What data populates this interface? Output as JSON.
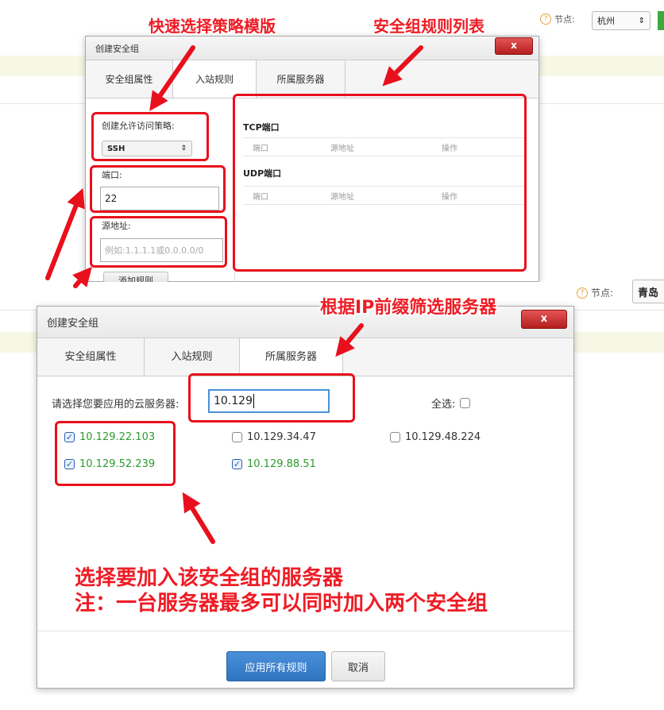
{
  "top_header": {
    "node_label": "节点:",
    "node_value": "杭州",
    "help_icon": "?"
  },
  "bottom_header": {
    "node_label": "节点:",
    "node_value": "青岛",
    "help_icon": "?"
  },
  "dialog1": {
    "title": "创建安全组",
    "close": "x",
    "tabs": [
      "安全组属性",
      "入站规则",
      "所属服务器"
    ],
    "active_tab": 1,
    "policy_label": "创建允许访问策略:",
    "policy_value": "SSH",
    "port_label": "端口:",
    "port_value": "22",
    "source_label": "源地址:",
    "source_placeholder": "例如:1.1.1.1或0.0.0.0/0",
    "add_rule_button": "添加规则",
    "tcp_title": "TCP端口",
    "udp_title": "UDP端口",
    "columns": [
      "端口",
      "源地址",
      "操作"
    ]
  },
  "dialog2": {
    "title": "创建安全组",
    "close": "x",
    "tabs": [
      "安全组属性",
      "入站规则",
      "所属服务器"
    ],
    "active_tab": 2,
    "filter_label": "请选择您要应用的云服务器:",
    "filter_value": "10.129",
    "select_all_label": "全选:",
    "servers": [
      {
        "ip": "10.129.22.103",
        "checked": true
      },
      {
        "ip": "10.129.34.47",
        "checked": false
      },
      {
        "ip": "10.129.48.224",
        "checked": false
      },
      {
        "ip": "10.129.52.239",
        "checked": true
      },
      {
        "ip": "10.129.88.51",
        "checked": true
      }
    ],
    "apply_button": "应用所有规则",
    "cancel_button": "取消"
  },
  "annotations": {
    "quick_template": "快速选择策略模版",
    "rule_list": "安全组规则列表",
    "ip_filter": "根据IP前缀筛选服务器",
    "choose_servers": "选择要加入该安全组的服务器",
    "note": "注：一台服务器最多可以同时加入两个安全组"
  },
  "colors": {
    "annotation_red": "#ee1c25",
    "checked_ip_green": "#2e9a2e",
    "primary_blue": "#2f74c0"
  }
}
